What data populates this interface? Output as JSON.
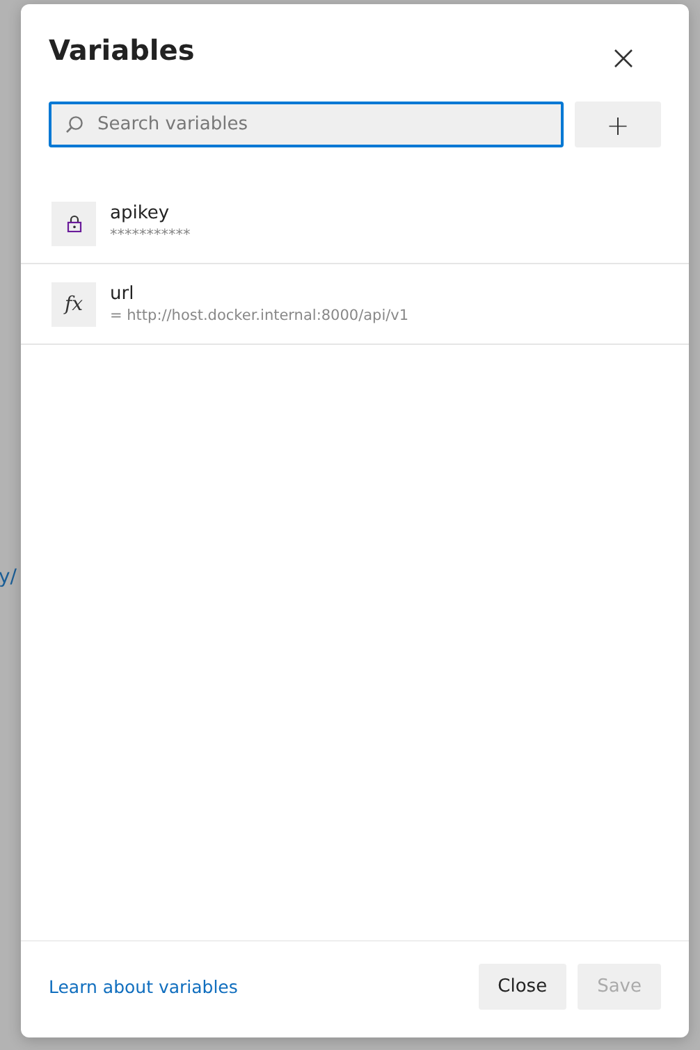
{
  "background": {
    "link_fragment": "y/"
  },
  "dialog": {
    "title": "Variables",
    "search": {
      "placeholder": "Search variables",
      "focused": true
    },
    "add_button": "+",
    "variables": [
      {
        "kind": "secret",
        "name": "apikey",
        "value": "***********"
      },
      {
        "kind": "expression",
        "icon_text": "fx",
        "name": "url",
        "value": "= http://host.docker.internal:8000/api/v1"
      }
    ],
    "footer": {
      "link": "Learn about variables",
      "buttons": [
        {
          "label": "Close",
          "disabled": false
        },
        {
          "label": "Save",
          "disabled": true
        }
      ]
    }
  }
}
